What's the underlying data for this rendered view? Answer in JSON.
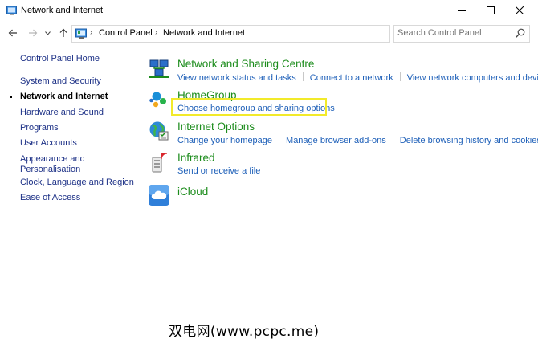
{
  "window": {
    "title": "Network and Internet"
  },
  "address_bar": {
    "breadcrumbs": [
      "Control Panel",
      "Network and Internet"
    ]
  },
  "search": {
    "placeholder": "Search Control Panel"
  },
  "sidebar": {
    "items": [
      {
        "label": "Control Panel Home",
        "active": false
      },
      {
        "label": "System and Security",
        "active": false
      },
      {
        "label": "Network and Internet",
        "active": true
      },
      {
        "label": "Hardware and Sound",
        "active": false
      },
      {
        "label": "Programs",
        "active": false
      },
      {
        "label": "User Accounts",
        "active": false
      },
      {
        "label": "Appearance and",
        "active": false
      },
      {
        "label": "Personalisation",
        "active": false
      },
      {
        "label": "Clock, Language and Region",
        "active": false
      },
      {
        "label": "Ease of Access",
        "active": false
      }
    ]
  },
  "categories": [
    {
      "title": "Network and Sharing Centre",
      "icon": "network-sharing-icon",
      "links": [
        "View network status and tasks",
        "Connect to a network",
        "View network computers and devices"
      ]
    },
    {
      "title": "HomeGroup",
      "icon": "homegroup-icon",
      "links": [
        "Choose homegroup and sharing options"
      ]
    },
    {
      "title": "Internet Options",
      "icon": "internet-options-icon",
      "links": [
        "Change your homepage",
        "Manage browser add-ons",
        "Delete browsing history and cookies"
      ]
    },
    {
      "title": "Infrared",
      "icon": "infrared-icon",
      "links": [
        "Send or receive a file"
      ]
    },
    {
      "title": "iCloud",
      "icon": "icloud-icon",
      "links": []
    }
  ],
  "colors": {
    "category_title": "#1c8c1c",
    "link": "#1d5fb8",
    "sidebar_link": "#1e3287",
    "highlight": "#f2ea2a"
  },
  "watermark": "双电网(www.pcpc.me)"
}
